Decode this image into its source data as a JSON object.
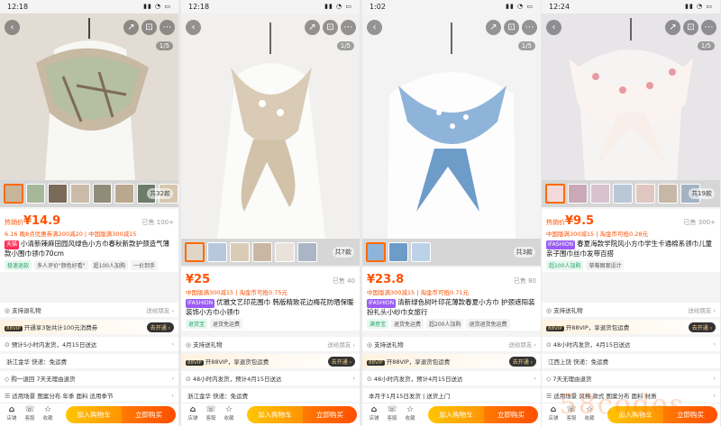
{
  "panels": [
    {
      "time": "12:18",
      "pager": "1/5",
      "cart_badge": "",
      "thumbs_count": "共32款",
      "price_label": "热销价",
      "price": "¥14.9",
      "sold": "已售 100+",
      "promo": "6.16 晚8点优惠券满200减20 | 中国版满300减15",
      "tag": "天猫",
      "title": "小清新辣麻田园风绿色小方巾春秋新款护颈造气薄款小围巾领巾70cm",
      "chips": [
        "极速退款",
        "多人评价\"颜色好看\"",
        "超100人加购",
        "一价到手"
      ],
      "rows": [
        {
          "icon": "◎",
          "left": "支持退礼物",
          "right": "送给朋友 ›"
        },
        {
          "vip": "88VIP",
          "left": "开通享3张共计100元消费券",
          "right": "去开通 ›"
        },
        {
          "icon": "⊙",
          "left": "预计5小时内发货，4月15日送达",
          "right": "›"
        },
        {
          "icon": "",
          "left": "浙江金华  快递：免运费",
          "right": ""
        },
        {
          "icon": "◇",
          "left": "购一退回    7天无理由退货",
          "right": "›"
        },
        {
          "icon": "☰",
          "left": "适用场景  图案分布  年季  面料  适用季节",
          "right": "›"
        }
      ],
      "buttons": {
        "shop": "店铺",
        "service": "客服",
        "fav": "收藏",
        "cart": "加入购物车",
        "buy": "立即购买"
      }
    },
    {
      "time": "12:18",
      "pager": "1/5",
      "cart_badge": "",
      "thumbs_count": "共7款",
      "price_label": "",
      "price": "¥25",
      "sold": "已售 40",
      "promo": "中国版满300减15 | 淘金币可抵0.75元",
      "tag": "IFASHION",
      "title": "优雅文艺印花围巾  韩版精致花边梅花防晒保暖装饰小方巾小领巾",
      "chips": [
        "退货宝",
        "退货免运费"
      ],
      "rows": [
        {
          "icon": "◎",
          "left": "支持送礼物",
          "right": "送给朋友 ›"
        },
        {
          "vip": "88VIP",
          "left": "开88VIP，享退货包运费",
          "right": "去开通 ›"
        },
        {
          "icon": "⊙",
          "left": "48小时内发货，预计4月15日送达",
          "right": "›"
        },
        {
          "icon": "",
          "left": "浙江金华  快递：免运费",
          "right": ""
        }
      ],
      "buttons": {
        "shop": "店铺",
        "service": "客服",
        "fav": "收藏",
        "cart": "加入购物车",
        "buy": "立即购买"
      }
    },
    {
      "time": "1:02",
      "pager": "1/5",
      "cart_badge": "",
      "thumbs_count": "共3款",
      "price_label": "",
      "price": "¥23.8",
      "sold": "已售 80",
      "promo": "中国版满300减15 | 淘金币可抵0.71元",
      "tag": "IFASHION",
      "title": "清新绿色树叶印花薄款春夏小方巾 护颈遮阳装扮礼头小纱巾女旅行",
      "chips": [
        "满意宝",
        "退货免运费",
        "超200人加购",
        "退货退货免运费"
      ],
      "rows": [
        {
          "icon": "◎",
          "left": "支持送礼物",
          "right": "送给朋友 ›"
        },
        {
          "vip": "88VIP",
          "left": "开88VIP，享退货包运费",
          "right": "去开通 ›"
        },
        {
          "icon": "⊙",
          "left": "48小时内发货，预计4月15日送达",
          "right": "›"
        },
        {
          "icon": "",
          "left": "本月于1月15日发货 | 送货上门",
          "right": ""
        }
      ],
      "buttons": {
        "shop": "店铺",
        "service": "客服",
        "fav": "收藏",
        "cart": "加入购物车",
        "buy": "立即购买"
      }
    },
    {
      "time": "12:24",
      "pager": "1/5",
      "cart_badge": "",
      "thumbs_count": "共19款",
      "price_label": "热销价",
      "price": "¥9.5",
      "sold": "已售 300+",
      "promo": "中国版满300减15 | 淘金币可抵0.28元",
      "tag": "IFASHION",
      "title": "春夏海款学院风小方巾学生卡通棉系领巾儿童亲子围巾丝巾发带百搭",
      "chips": [
        "超100人加购",
        "草莓图案设计"
      ],
      "rows": [
        {
          "icon": "◎",
          "left": "支持送礼物",
          "right": "送给朋友 ›"
        },
        {
          "vip": "88VIP",
          "left": "开88VIP，享退货包运费",
          "right": "去开通 ›"
        },
        {
          "icon": "⊙",
          "left": "48小时内发货，4月15日送达",
          "right": "›"
        },
        {
          "icon": "",
          "left": "江西上饶  快递：免运费",
          "right": ""
        },
        {
          "icon": "◇",
          "left": "7天无理由退货",
          "right": "›"
        },
        {
          "icon": "☰",
          "left": "适用场景  风格  款式  图案分布  面料  材质",
          "right": "›"
        }
      ],
      "buttons": {
        "shop": "店铺",
        "service": "客服",
        "fav": "收藏",
        "cart": "加入购物车",
        "buy": "立即购买"
      }
    }
  ],
  "watermark": "58codes",
  "colors": {
    "accent": "#ff5000",
    "cart_btn": "#ffa200",
    "buy_btn": "#ff5a00"
  }
}
